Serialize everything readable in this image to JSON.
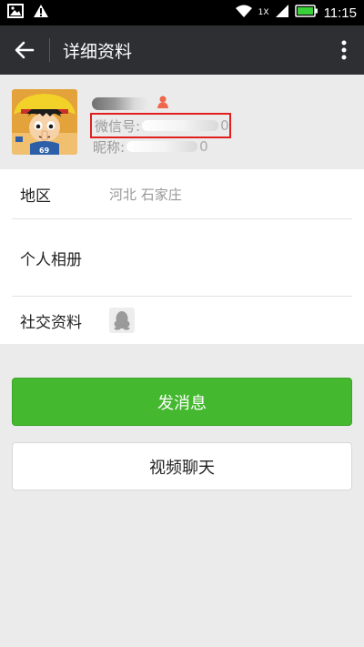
{
  "status_bar": {
    "time": "11:15",
    "network": "1X",
    "icons": [
      "image-icon",
      "warning-icon",
      "wifi-icon",
      "signal-icon",
      "battery-icon"
    ],
    "battery_color": "#3ad23a"
  },
  "header": {
    "title": "详细资料",
    "back_icon": "arrow-left-icon",
    "menu_icon": "more-vertical-icon"
  },
  "profile": {
    "gender_icon": "female-icon",
    "wechat_id_label": "微信号:",
    "wechat_id_tail": "0",
    "nickname_label": "昵称:",
    "nickname_tail": "0",
    "highlight_color": "#e02020"
  },
  "info": {
    "region_label": "地区",
    "region_value": "河北  石家庄",
    "album_label": "个人相册",
    "social_label": "社交资料",
    "social_icon": "qq-penguin-icon"
  },
  "buttons": {
    "send_label": "发消息",
    "video_label": "视频聊天",
    "send_color": "#44b82e"
  }
}
